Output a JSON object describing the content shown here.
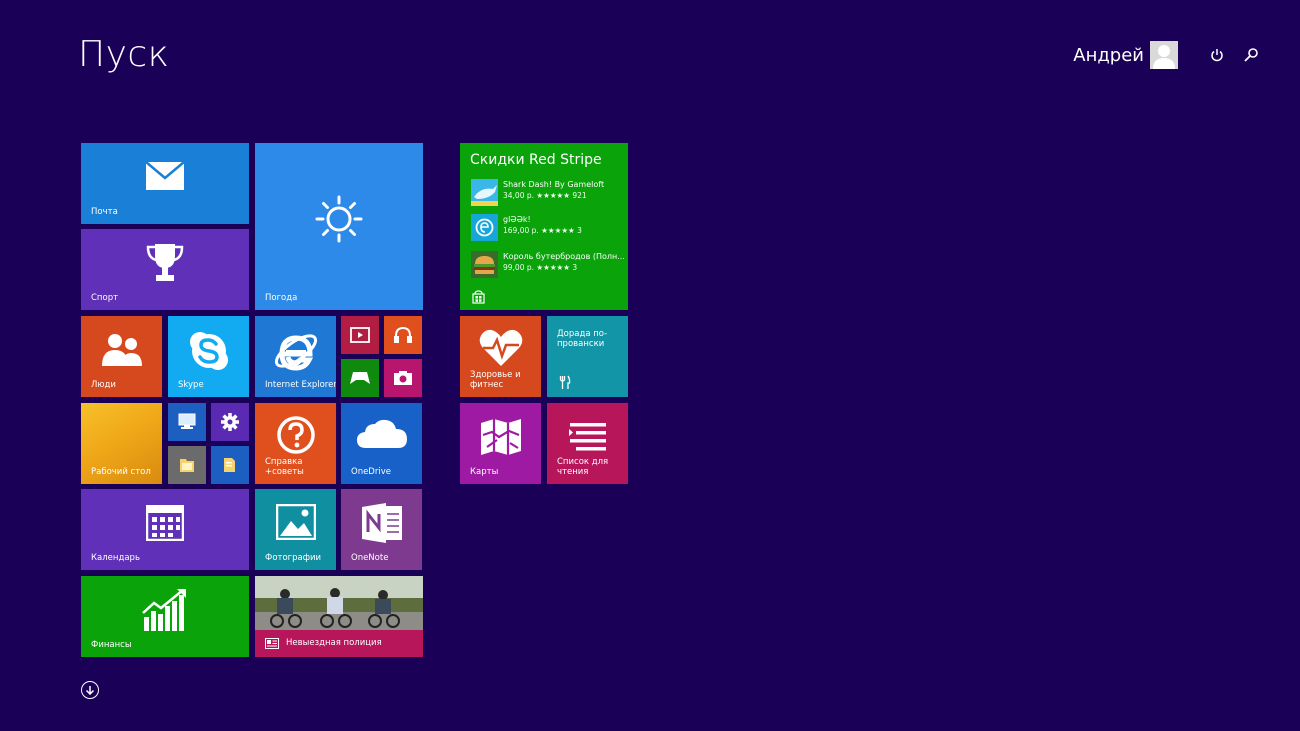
{
  "header": {
    "title": "Пуск",
    "user_name": "Андрей"
  },
  "colors": {
    "background": "#1b0058",
    "blue": "#1a7fd7",
    "purple": "#6031b8",
    "orange": "#d6491f",
    "green": "#0aa30a",
    "teal": "#1295a6",
    "magenta": "#9e1aa2",
    "crimson": "#b8165b"
  },
  "tiles": {
    "mail": {
      "label": "Почта",
      "icon": "mail-icon"
    },
    "weather": {
      "label": "Погода",
      "icon": "sun-icon"
    },
    "sport": {
      "label": "Спорт",
      "icon": "trophy-icon"
    },
    "people": {
      "label": "Люди",
      "icon": "people-icon"
    },
    "skype": {
      "label": "Skype",
      "icon": "skype-icon"
    },
    "ie": {
      "label": "Internet Explorer",
      "icon": "internet-explorer-icon"
    },
    "desktop": {
      "label": "Рабочий стол"
    },
    "help": {
      "label": "Справка +советы",
      "icon": "question-icon"
    },
    "onedrive": {
      "label": "OneDrive",
      "icon": "cloud-icon"
    },
    "calendar": {
      "label": "Календарь",
      "icon": "calendar-icon"
    },
    "photos": {
      "label": "Фотографии",
      "icon": "photo-icon"
    },
    "onenote": {
      "label": "OneNote",
      "icon": "onenote-icon"
    },
    "finance": {
      "label": "Финансы",
      "icon": "chart-icon"
    },
    "news": {
      "label": "Невыездная полиция",
      "icon": "newspaper-icon"
    },
    "health": {
      "label": "Здоровье и фитнес",
      "icon": "heart-icon"
    },
    "food": {
      "label": "Дорада по-провански",
      "icon": "fork-knife-icon"
    },
    "maps": {
      "label": "Карты",
      "icon": "map-icon"
    },
    "reading": {
      "label": "Список для чтения",
      "icon": "reading-list-icon"
    }
  },
  "store": {
    "title": "Скидки Red Stripe",
    "items": [
      {
        "name": "Shark Dash! By Gameloft",
        "price": "34,00 р. ★★★★★ 921"
      },
      {
        "name": "glƏƏk!",
        "price": "169,00 р. ★★★★★ 3"
      },
      {
        "name": "Король бутербродов (Полн...",
        "price": "99,00 р. ★★★★★ 3"
      }
    ]
  }
}
